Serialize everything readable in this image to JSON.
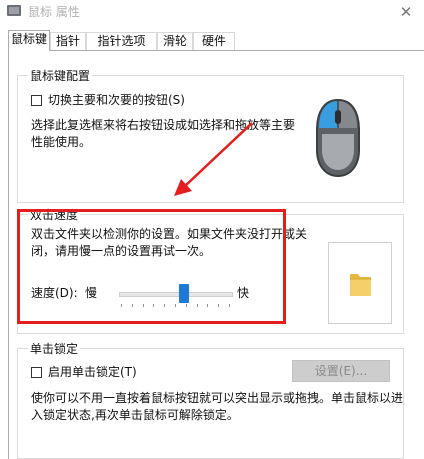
{
  "window": {
    "title": "鼠标 属性",
    "close_glyph": "✕"
  },
  "tabs": [
    {
      "label": "鼠标键",
      "active": true
    },
    {
      "label": "指针",
      "active": false
    },
    {
      "label": "指针选项",
      "active": false
    },
    {
      "label": "滑轮",
      "active": false
    },
    {
      "label": "硬件",
      "active": false
    }
  ],
  "button_config": {
    "title": "鼠标键配置",
    "switch_checkbox_label": "切换主要和次要的按钮(S)",
    "switch_checked": false,
    "description_line1": "选择此复选框来将右按钮设成如选择和拖放等主要",
    "description_line2": "性能使用。"
  },
  "double_click": {
    "title": "双击速度",
    "description_line1": "双击文件夹以检测你的设置。如果文件夹没打开或关",
    "description_line2": "闭，请用慢一点的设置再试一次。",
    "speed_label": "速度(D):",
    "slow_label": "慢",
    "fast_label": "快",
    "speed_fraction": 0.58
  },
  "click_lock": {
    "title": "单击锁定",
    "checkbox_label": "启用单击锁定(T)",
    "checked": false,
    "settings_button_label": "设置(E)...",
    "settings_enabled": false,
    "description_line1": "使你可以不用一直按着鼠标按钮就可以突出显示或拖拽。单击鼠标以进",
    "description_line2": "入锁定状态,再次单击鼠标可解除锁定。"
  },
  "colors": {
    "accent": "#1e7ad6",
    "highlight": "#e41e1e",
    "mouse_button": "#3a9de0",
    "folder": "#f4cf6a"
  }
}
